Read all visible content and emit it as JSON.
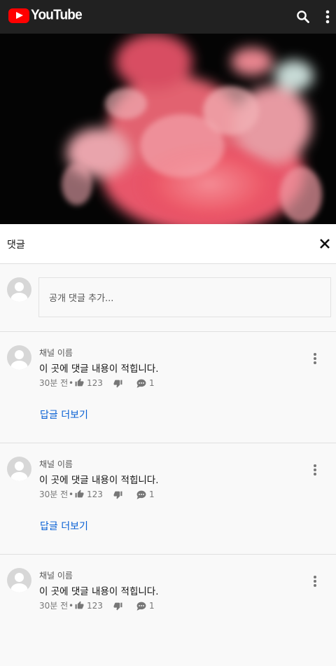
{
  "app": {
    "logo_text": "YouTube",
    "brand_color": "#ff0000"
  },
  "topbar": {
    "search_icon": "search-icon",
    "menu_icon": "more-vert-icon"
  },
  "comments_panel": {
    "title": "댓글",
    "close_icon": "close-icon",
    "add_placeholder": "공개 댓글 추가..."
  },
  "comments": [
    {
      "channel": "채널 이름",
      "text": "이 곳에 댓글 내용이 적힙니다.",
      "time": "30분 전",
      "dot": "•",
      "likes": "123",
      "replies": "1",
      "more_replies": "답글 더보기"
    },
    {
      "channel": "채널 이름",
      "text": "이 곳에 댓글 내용이 적힙니다.",
      "time": "30분 전",
      "dot": "•",
      "likes": "123",
      "replies": "1",
      "more_replies": "답글 더보기"
    },
    {
      "channel": "채널 이름",
      "text": "이 곳에 댓글 내용이 적힙니다.",
      "time": "30분 전",
      "dot": "•",
      "likes": "123",
      "replies": "1"
    }
  ]
}
